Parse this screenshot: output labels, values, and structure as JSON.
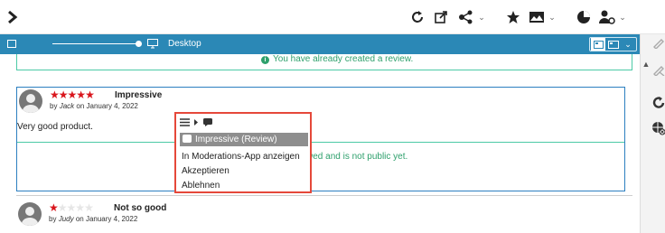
{
  "toolbar": {
    "icons": [
      "chevron-right-icon",
      "reload-icon",
      "open-external-icon",
      "share-icon",
      "star-icon",
      "image-icon",
      "pie-chart-icon",
      "user-settings-icon"
    ]
  },
  "device_bar": {
    "label": "Desktop",
    "bg_color": "#2b88b6"
  },
  "notice": {
    "text": "You have already created a review."
  },
  "reviews": [
    {
      "stars_filled": 5,
      "stars_total": 5,
      "title": "Impressive",
      "by_prefix": "by",
      "author": "Jack",
      "date_text": "on January 4, 2022",
      "body": "Very good product.",
      "status": "g reviewed and is not public yet."
    },
    {
      "stars_filled": 1,
      "stars_total": 5,
      "title": "Not so good",
      "by_prefix": "by",
      "author": "Judy",
      "date_text": "on January 4, 2022"
    }
  ],
  "context_menu": {
    "toolbar_icons": [
      "hamburger-icon",
      "chevron-right-icon",
      "chat-icon"
    ],
    "items": [
      {
        "label": "Impressive (Review)",
        "selected": true
      },
      {
        "label": "In Moderations-App anzeigen"
      },
      {
        "label": "Akzeptieren"
      },
      {
        "label": "Ablehnen"
      }
    ],
    "border_color": "#e5483a"
  },
  "colors": {
    "star_on": "#d9151c",
    "success_text": "#2ea06c",
    "card_border": "#2c7fc0"
  }
}
